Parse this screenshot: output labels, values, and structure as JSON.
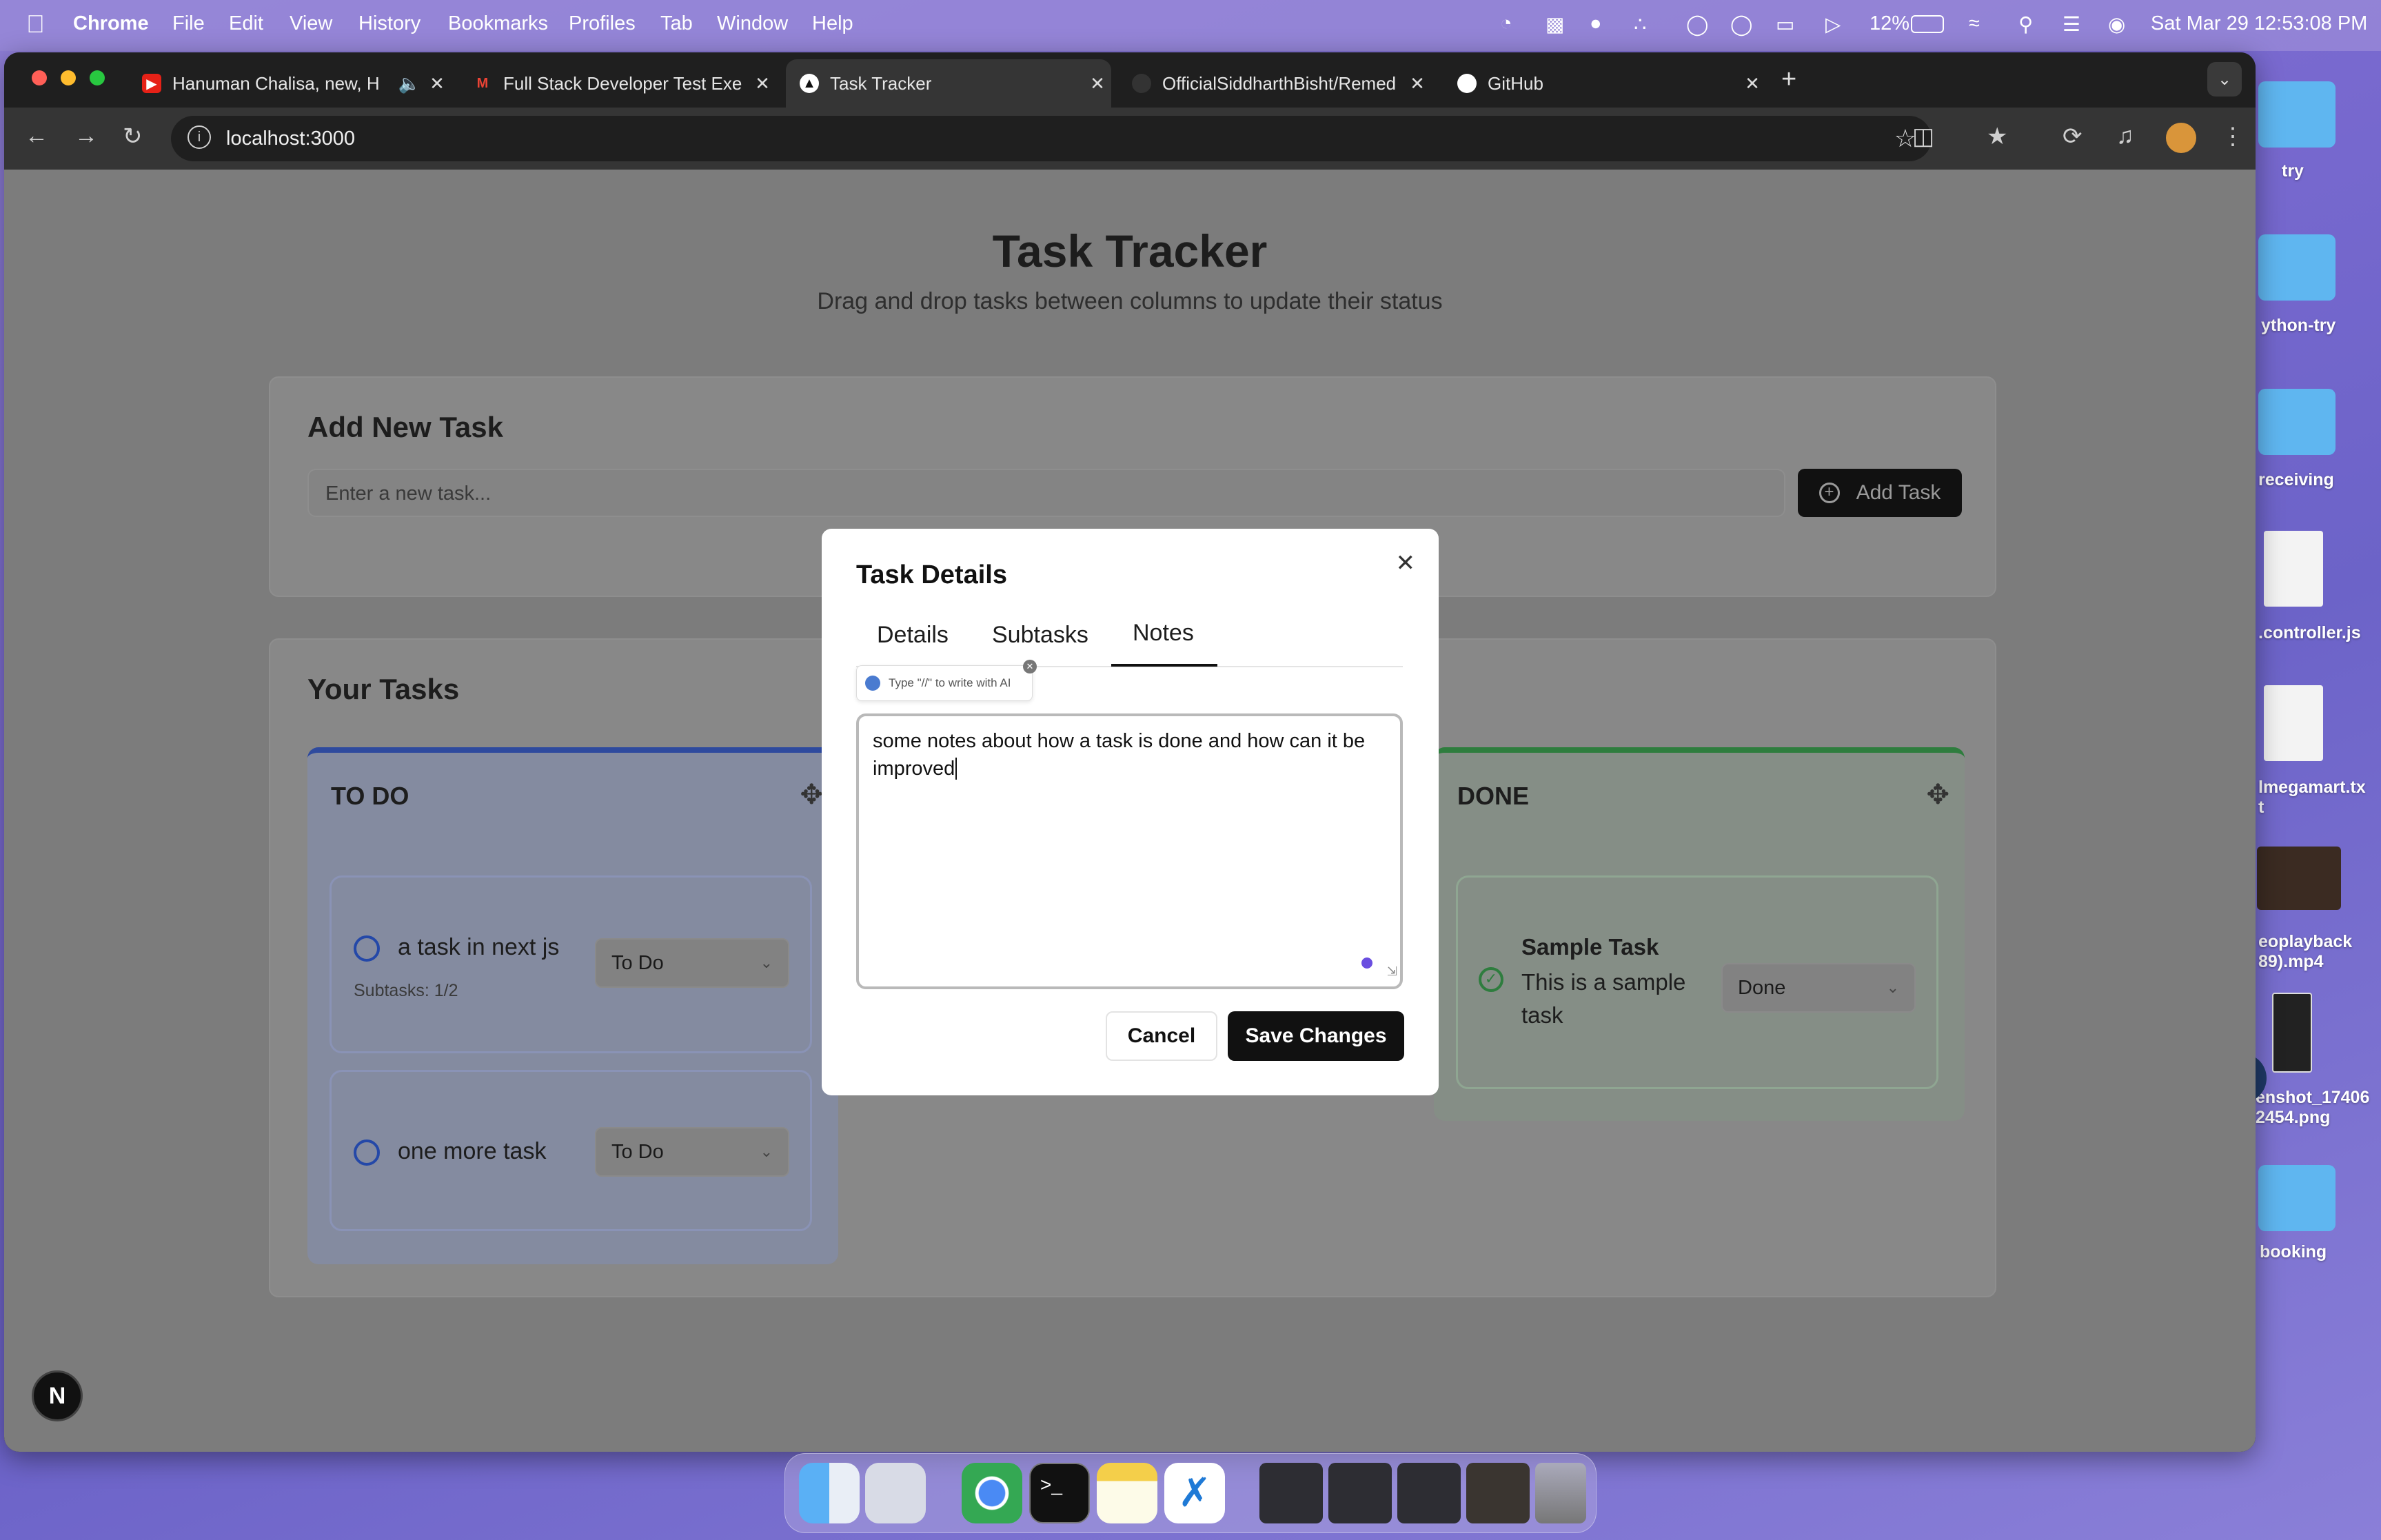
{
  "menubar": {
    "app": "Chrome",
    "items": [
      "File",
      "Edit",
      "View",
      "History",
      "Bookmarks",
      "Profiles",
      "Tab",
      "Window",
      "Help"
    ],
    "battery": "12%",
    "datetime": "Sat Mar 29  12:53:08 PM"
  },
  "browser": {
    "tabs": [
      {
        "title": "Hanuman Chalisa, new, H",
        "favicon": "youtube-icon",
        "color": "#e62117"
      },
      {
        "title": "Full Stack Developer Test Exe",
        "favicon": "gmail-icon",
        "color": "#ea4335"
      },
      {
        "title": "Task Tracker",
        "favicon": "triangle-icon",
        "color": "#ffffff"
      },
      {
        "title": "OfficialSiddharthBisht/Remed",
        "favicon": "github-icon",
        "color": "#333333"
      },
      {
        "title": "GitHub",
        "favicon": "github-icon",
        "color": "#ffffff"
      }
    ],
    "url": "localhost:3000"
  },
  "app": {
    "title": "Task Tracker",
    "subtitle": "Drag and drop tasks between columns to update their status",
    "add_section": {
      "heading": "Add New Task",
      "placeholder": "Enter a new task...",
      "button": "Add Task"
    },
    "tasks_heading": "Your Tasks",
    "columns": [
      {
        "title": "TO DO",
        "accent": "#2e5bd8",
        "tasks": [
          {
            "title": "a task in next js",
            "meta": "Subtasks: 1/2",
            "status": "To Do"
          },
          {
            "title": "one more task",
            "status": "To Do"
          }
        ]
      },
      {
        "title": "DONE",
        "accent": "#2f9e44",
        "tasks": [
          {
            "title": "Sample Task",
            "description": "This is a sample task",
            "status": "Done"
          }
        ]
      }
    ]
  },
  "modal": {
    "title": "Task Details",
    "tabs": [
      "Details",
      "Subtasks",
      "Notes"
    ],
    "active_tab": "Notes",
    "ai_hint": "Type \"//\" to write with AI",
    "notes_value": "some notes about how a task is done and how can it be improved",
    "cancel": "Cancel",
    "save": "Save Changes"
  },
  "desktop": {
    "items": [
      "try",
      "ython-try",
      "receiving",
      ".controller.js",
      "lmegamart.tx t",
      "eoplayback 89).mp4",
      "enshot_17406 2454.png",
      "booking"
    ]
  },
  "nextjs_badge": "N"
}
